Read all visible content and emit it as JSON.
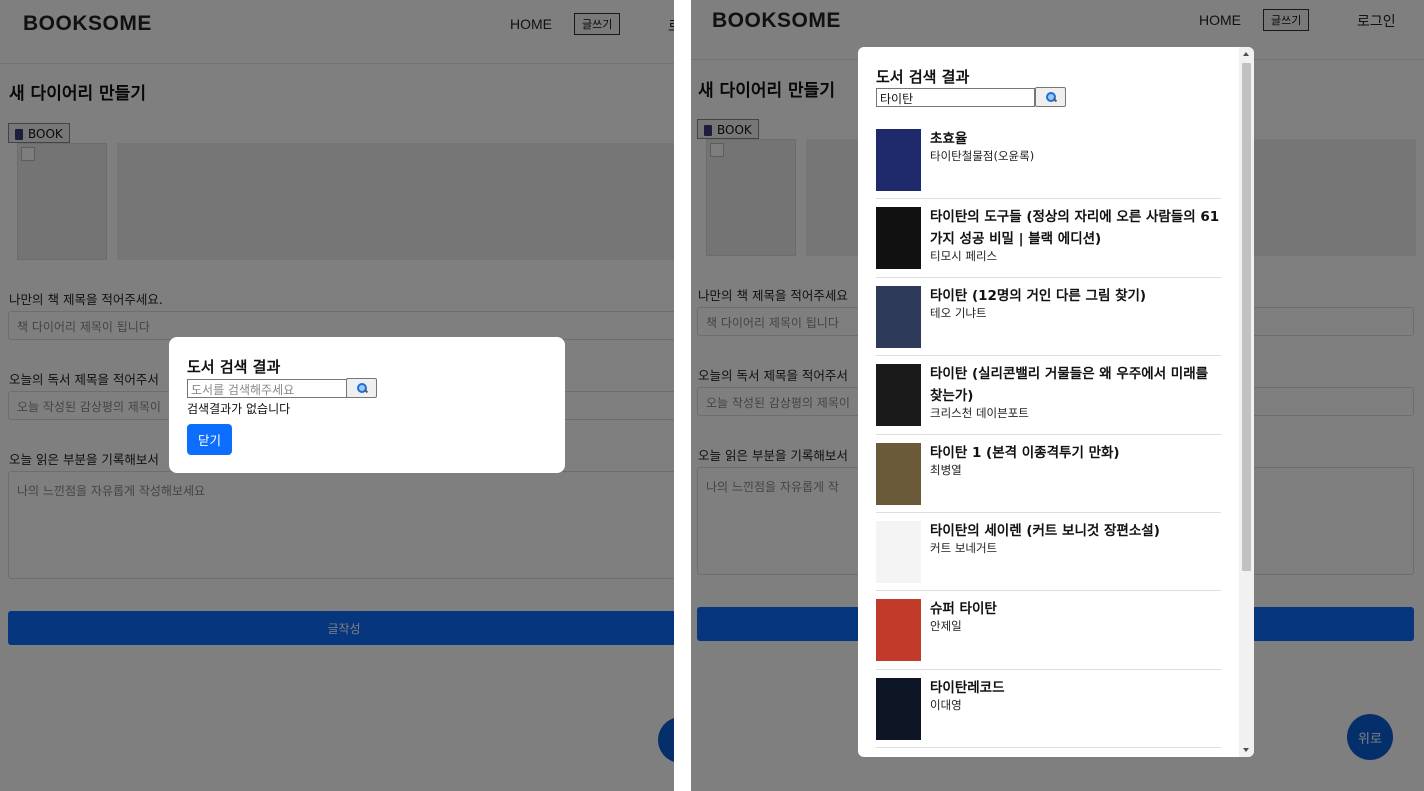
{
  "header": {
    "logo": "BOOKSOME",
    "nav_home": "HOME",
    "nav_write": "글쓰기",
    "nav_login": "로그인",
    "nav_login_cut": "로"
  },
  "page": {
    "title": "새 다이어리 만들기",
    "book_button": "BOOK",
    "book_title_label": "나만의 책 제목을 적어주세요.",
    "book_title_label_cut": "나만의 책 제목을 적어주세요",
    "book_title_placeholder": "책 다이어리 제목이 됩니다",
    "reading_title_label_cut": "오늘의 독서 제목을 적어주서",
    "reading_title_placeholder_cut": "오늘 작성된 감상평의 제목이",
    "reading_part_label_cut": "오늘 읽은 부분을 기록해보서",
    "textarea_placeholder": "나의 느낀점을 자유롭게 작성해보세요",
    "textarea_placeholder_cut": "나의 느낀점을 자유롭게 작",
    "submit_button": "글작성",
    "top_button": "위로",
    "top_button_cut": "위"
  },
  "modal_empty": {
    "title": "도서 검색 결과",
    "search_placeholder": "도서를 검색해주세요",
    "no_result": "검색결과가 없습니다",
    "close_button": "닫기"
  },
  "modal_results": {
    "title": "도서 검색 결과",
    "search_value": "타이탄",
    "items": [
      {
        "title": "초효율",
        "author": "타이탄철물점(오윤록)",
        "cover_color": "#1e2a6b"
      },
      {
        "title": "타이탄의 도구들 (정상의 자리에 오른 사람들의 61가지 성공 비밀 | 블랙 에디션)",
        "author": "티모시 페리스",
        "cover_color": "#111111"
      },
      {
        "title": "타이탄 (12명의 거인 다른 그림 찾기)",
        "author": "테오 기냐트",
        "cover_color": "#2d3a5a"
      },
      {
        "title": "타이탄 (실리콘밸리 거물들은 왜 우주에서 미래를 찾는가)",
        "author": "크리스천 데이븐포트",
        "cover_color": "#1a1a1a"
      },
      {
        "title": "타이탄 1 (본격 이종격투기 만화)",
        "author": "최병열",
        "cover_color": "#6b5a3a"
      },
      {
        "title": "타이탄의 세이렌 (커트 보니것 장편소설)",
        "author": "커트 보네거트",
        "cover_color": "#f4f4f4"
      },
      {
        "title": "슈퍼 타이탄",
        "author": "안제일",
        "cover_color": "#c23a2a"
      },
      {
        "title": "타이탄레코드",
        "author": "이대영",
        "cover_color": "#0e1626"
      }
    ]
  },
  "colors": {
    "primary": "#0d6efd",
    "overlay": "rgba(0,0,0,0.5)"
  }
}
